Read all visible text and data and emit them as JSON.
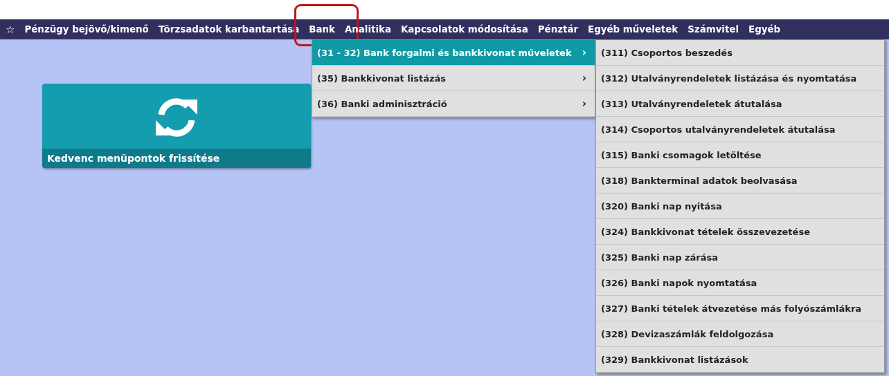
{
  "nav": {
    "star": "☆",
    "items": [
      {
        "label": "Pénzügy bejövő/kimenő",
        "annotated": false
      },
      {
        "label": "Törzsadatok karbantartása",
        "annotated": false
      },
      {
        "label": "Bank",
        "annotated": true
      },
      {
        "label": "Analitika",
        "annotated": false
      },
      {
        "label": "Kapcsolatok módosítása",
        "annotated": false
      },
      {
        "label": "Pénztár",
        "annotated": false
      },
      {
        "label": "Egyéb műveletek",
        "annotated": false
      },
      {
        "label": "Számvitel",
        "annotated": false
      },
      {
        "label": "Egyéb",
        "annotated": false
      }
    ]
  },
  "menu": {
    "items": [
      {
        "label": "(31 - 32) Bank forgalmi és bankkivonat műveletek",
        "arrow": "›",
        "selected": true
      },
      {
        "label": "(35) Bankkivonat listázás",
        "arrow": "›",
        "selected": false
      },
      {
        "label": "(36) Banki adminisztráció",
        "arrow": "›",
        "selected": false
      }
    ]
  },
  "submenu": {
    "items": [
      "(311) Csoportos beszedés",
      "(312) Utalványrendeletek listázása és nyomtatása",
      "(313) Utalványrendeletek átutalása",
      "(314) Csoportos utalványrendeletek átutalása",
      "(315) Banki csomagok letöltése",
      "(318) Bankterminal adatok beolvasása",
      "(320) Banki nap nyitása",
      "(324) Bankkivonat tételek összevezetése",
      "(325) Banki nap zárása",
      "(326) Banki napok nyomtatása",
      "(327) Banki tételek átvezetése más folyószámlákra",
      "(328) Devizaszámlák feldolgozása",
      "(329) Bankkivonat listázások"
    ]
  },
  "tile": {
    "label": "Kedvenc menüpontok frissítése"
  }
}
